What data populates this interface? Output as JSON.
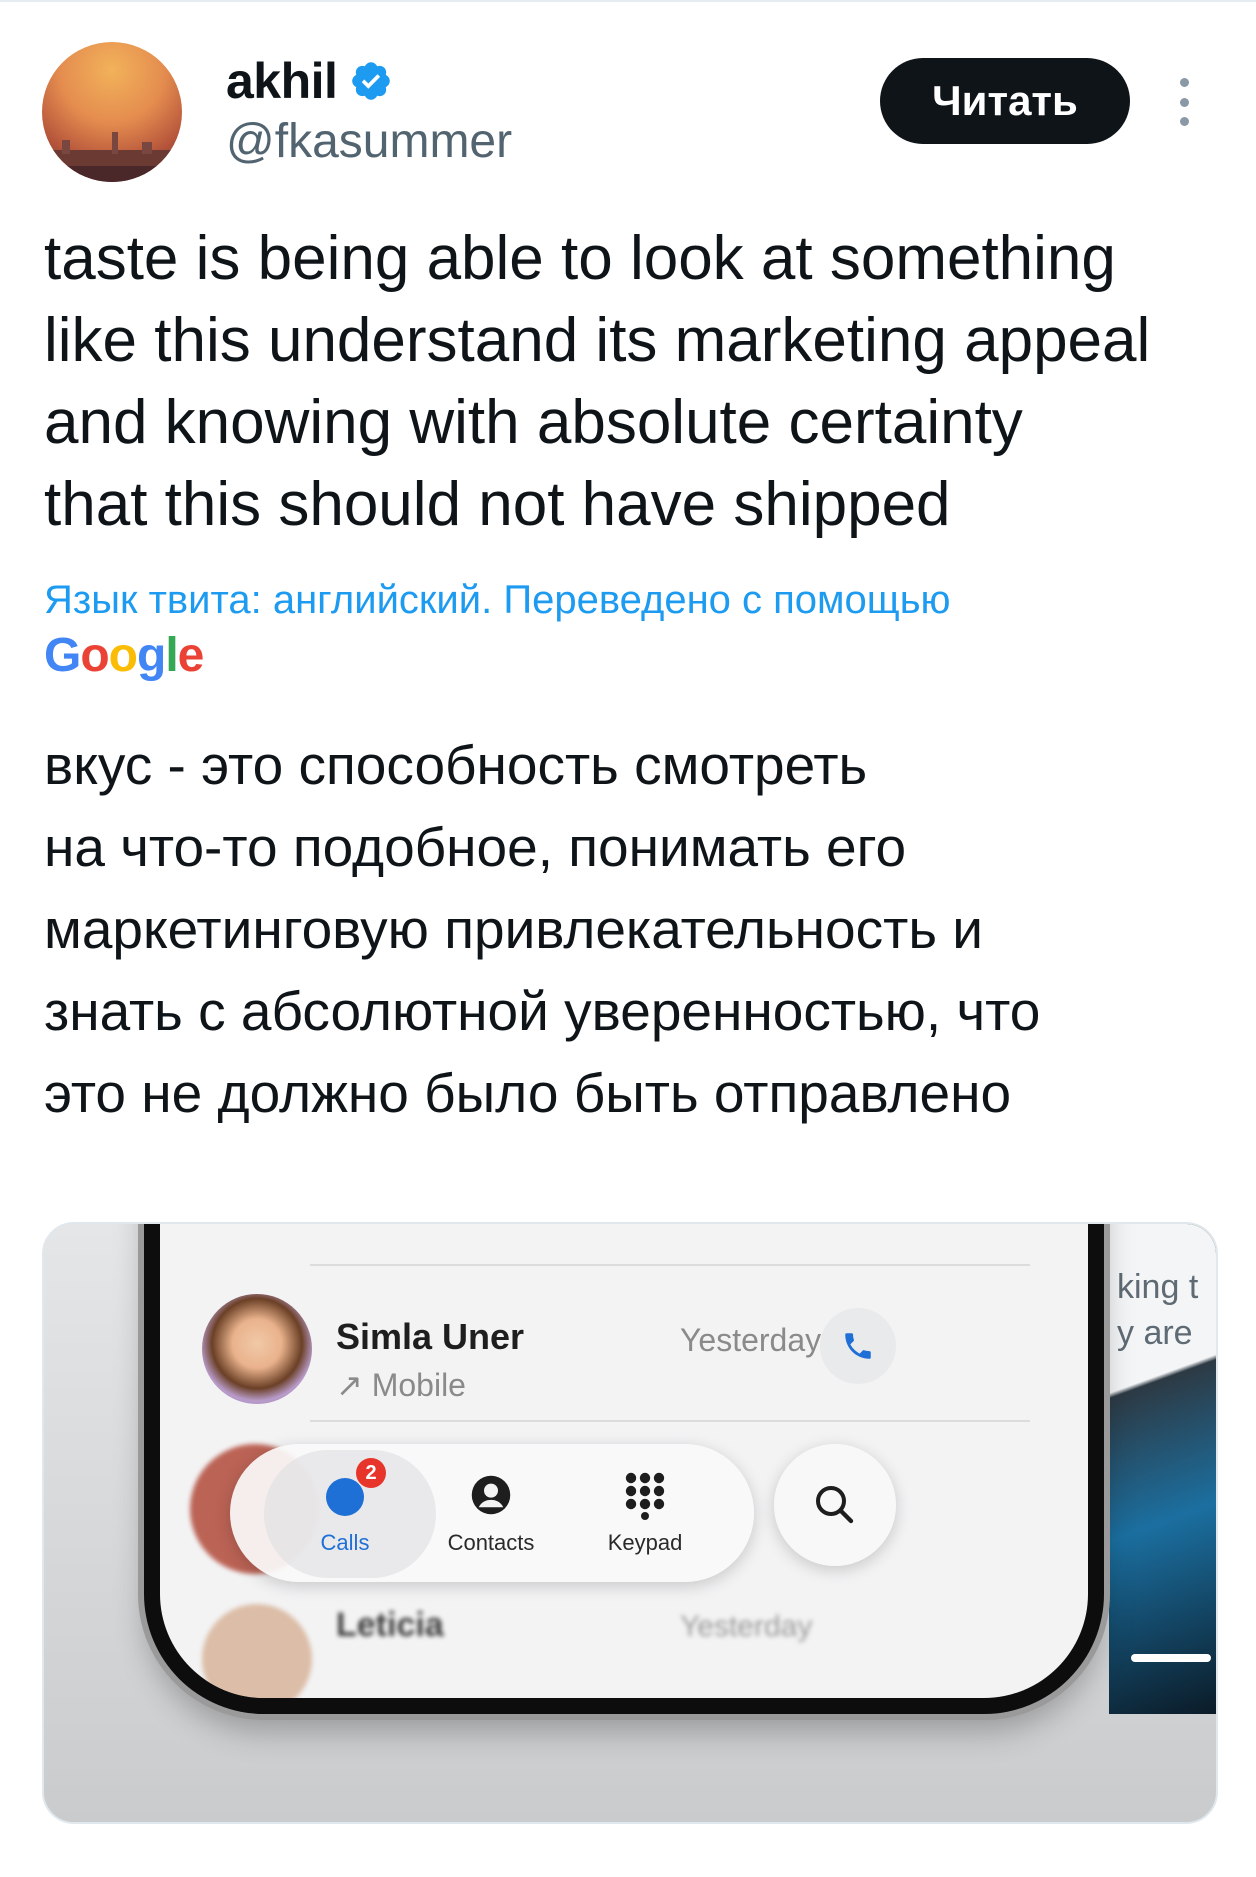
{
  "author": {
    "name": "akhil",
    "handle": "@fkasummer",
    "verified_color": "#1d9bf0"
  },
  "header": {
    "read_button_label": "Читать"
  },
  "tweet": {
    "text": "taste is being able to look at something\nlike this understand its marketing appeal\nand knowing with absolute certainty\nthat this should not have shipped",
    "translation_note": "Язык твита: английский. Переведено с помощью",
    "translation_provider": {
      "g1": "G",
      "o1": "o",
      "o2": "o",
      "g2": "g",
      "l": "l",
      "e": "e"
    },
    "translated_text": "вкус - это способность смотреть\nна что-то подобное, понимать его\nмаркетинговую привлекательность и\nзнать с абсолютной уверенностью, что\nэто не должно было быть отправлено"
  },
  "media": {
    "contact": {
      "name": "Simla Uner",
      "type": "↗ Mobile",
      "time": "Yesterday"
    },
    "background_contacts": {
      "partial_bottom": "Leticia",
      "partial_bottom_time": "Yesterday"
    },
    "tabs": [
      {
        "label": "Calls",
        "badge": "2"
      },
      {
        "label": "Contacts"
      },
      {
        "label": "Keypad"
      }
    ],
    "side_text": {
      "line1": "king t",
      "line2": "y are"
    },
    "accent_color": "#1e6fd6"
  }
}
